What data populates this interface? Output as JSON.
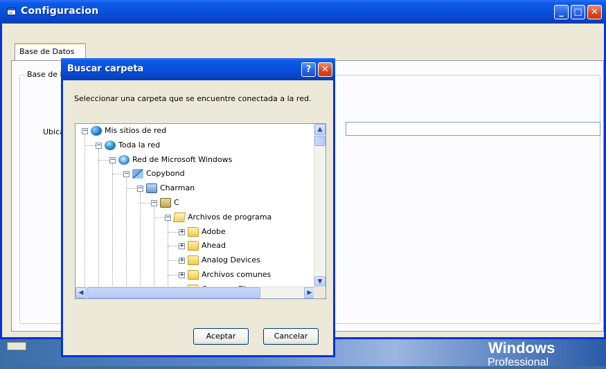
{
  "main_window": {
    "title": "Configuracion",
    "tab_label": "Base de Datos",
    "group_label": "Base de Datos",
    "location_label": "Ubicación:",
    "location_value": ""
  },
  "dialog": {
    "title": "Buscar carpeta",
    "help_glyph": "?",
    "close_glyph": "✕",
    "description": "Seleccionar una carpeta que se encuentre conectada a la red.",
    "ok_label": "Aceptar",
    "cancel_label": "Cancelar"
  },
  "tree": [
    {
      "label": "Mis sitios de red",
      "icon": "network-places-icon",
      "expanded": true
    },
    {
      "label": "Toda la red",
      "icon": "entire-network-icon",
      "expanded": true
    },
    {
      "label": "Red de Microsoft Windows",
      "icon": "windows-network-icon",
      "expanded": true
    },
    {
      "label": "Copybond",
      "icon": "workgroup-icon",
      "expanded": true
    },
    {
      "label": "Charman",
      "icon": "computer-icon",
      "expanded": true
    },
    {
      "label": "C",
      "icon": "shared-drive-icon",
      "expanded": true
    },
    {
      "label": "Archivos de programa",
      "icon": "folder-open-icon",
      "expanded": true
    },
    {
      "label": "Adobe",
      "icon": "folder-icon",
      "expanded": false
    },
    {
      "label": "Ahead",
      "icon": "folder-icon",
      "expanded": false
    },
    {
      "label": "Analog Devices",
      "icon": "folder-icon",
      "expanded": false
    },
    {
      "label": "Archivos comunes",
      "icon": "folder-icon",
      "expanded": false
    },
    {
      "label": "Common Files",
      "icon": "folder-icon",
      "expanded": false
    }
  ],
  "taskbar": {
    "brand_line1": "Windows",
    "brand_line2": "Professional"
  },
  "colors": {
    "titlebar": "#0a4fd9",
    "window_bg": "#ece9d8",
    "close_button": "#d9451e",
    "desktop": "#3a6ea5"
  }
}
